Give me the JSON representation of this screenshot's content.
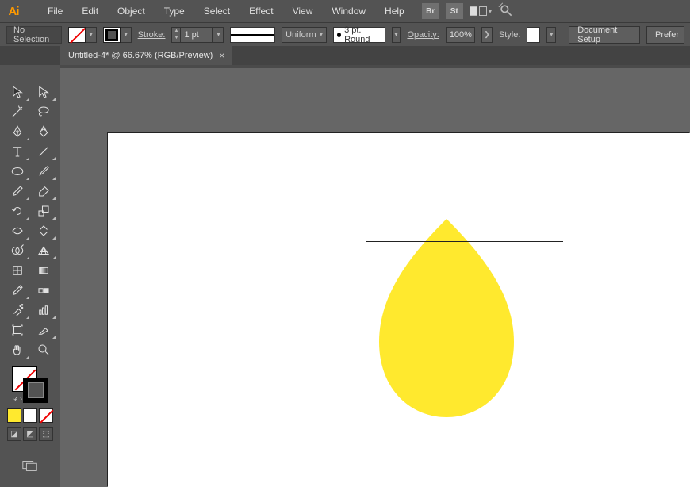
{
  "app": {
    "logo_text": "Ai"
  },
  "menu": {
    "file": "File",
    "edit": "Edit",
    "object": "Object",
    "type": "Type",
    "select": "Select",
    "effect": "Effect",
    "view": "View",
    "window": "Window",
    "help": "Help"
  },
  "menubar_right": {
    "bridge_btn": "Br",
    "stock_btn": "St"
  },
  "controlbar": {
    "selection_status": "No Selection",
    "stroke_label": "Stroke:",
    "stroke_weight": "1 pt",
    "uniform_label": "Uniform",
    "brush_width_label": "3 pt. Round",
    "opacity_label": "Opacity:",
    "opacity_value": "100%",
    "style_label": "Style:",
    "document_setup_btn": "Document Setup",
    "preferences_btn": "Prefer"
  },
  "tab": {
    "title": "Untitled-4* @ 66.67% (RGB/Preview)",
    "close_glyph": "×"
  },
  "canvas": {
    "shape_fill": "#ffe92e",
    "guide_color": "#222"
  },
  "tools": {
    "row0": [
      "selection",
      "direct-selection"
    ],
    "row1": [
      "magic-wand",
      "lasso"
    ],
    "row2": [
      "pen",
      "curvature"
    ],
    "row3": [
      "type",
      "line-segment"
    ],
    "row4": [
      "ellipse",
      "paintbrush"
    ],
    "row5": [
      "pencil",
      "eraser"
    ],
    "row6": [
      "rotate",
      "scale"
    ],
    "row7": [
      "width",
      "free-transform"
    ],
    "row8": [
      "shape-builder",
      "perspective-grid"
    ],
    "row9": [
      "mesh",
      "gradient"
    ],
    "row10": [
      "eyedropper",
      "blend"
    ],
    "row11": [
      "symbol-sprayer",
      "column-graph"
    ],
    "row12": [
      "artboard",
      "slice"
    ],
    "row13": [
      "hand",
      "zoom"
    ]
  }
}
